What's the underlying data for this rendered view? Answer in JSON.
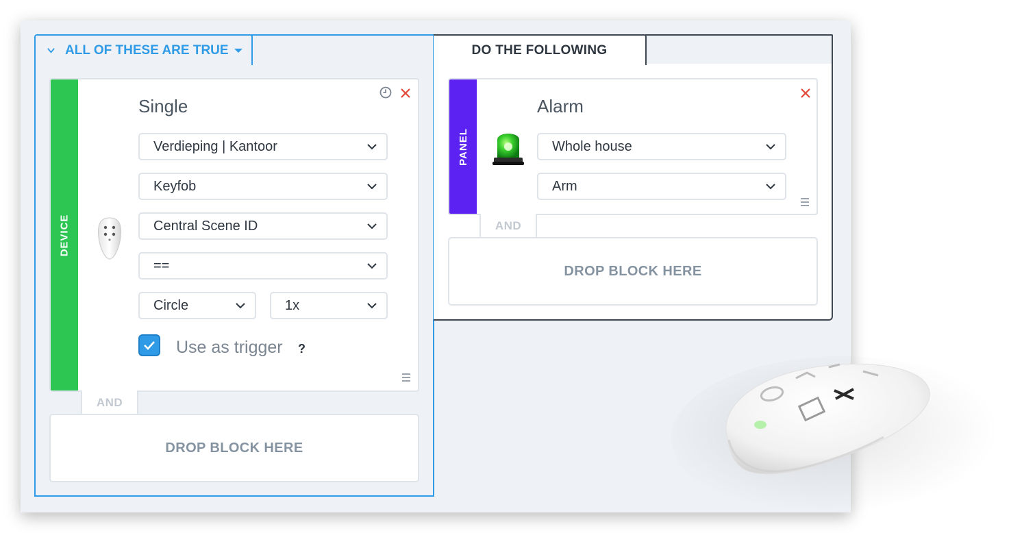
{
  "condition": {
    "header_label": "ALL OF THESE ARE TRUE",
    "block": {
      "category": "DEVICE",
      "category_color": "#2dc653",
      "title": "Single",
      "selects": {
        "location": "Verdieping | Kantoor",
        "device": "Keyfob",
        "property": "Central Scene ID",
        "operator": "==",
        "button": "Circle",
        "press": "1x"
      },
      "trigger": {
        "checked": true,
        "label": "Use as trigger",
        "help": "?"
      },
      "icons": [
        "clock-icon",
        "close-icon",
        "drag-handle-icon"
      ]
    },
    "and_label": "AND",
    "drop_label": "DROP BLOCK HERE"
  },
  "action": {
    "header_label": "DO THE FOLLOWING",
    "block": {
      "category": "PANEL",
      "category_color": "#5b22f2",
      "title": "Alarm",
      "selects": {
        "zone": "Whole house",
        "mode": "Arm"
      },
      "icons": [
        "alarm-siren-icon",
        "close-icon",
        "drag-handle-icon"
      ]
    },
    "and_label": "AND",
    "drop_label": "DROP BLOCK HERE"
  },
  "colors": {
    "accent": "#2f9be6",
    "close": "#e5483b",
    "dark_border": "#3d4651"
  }
}
